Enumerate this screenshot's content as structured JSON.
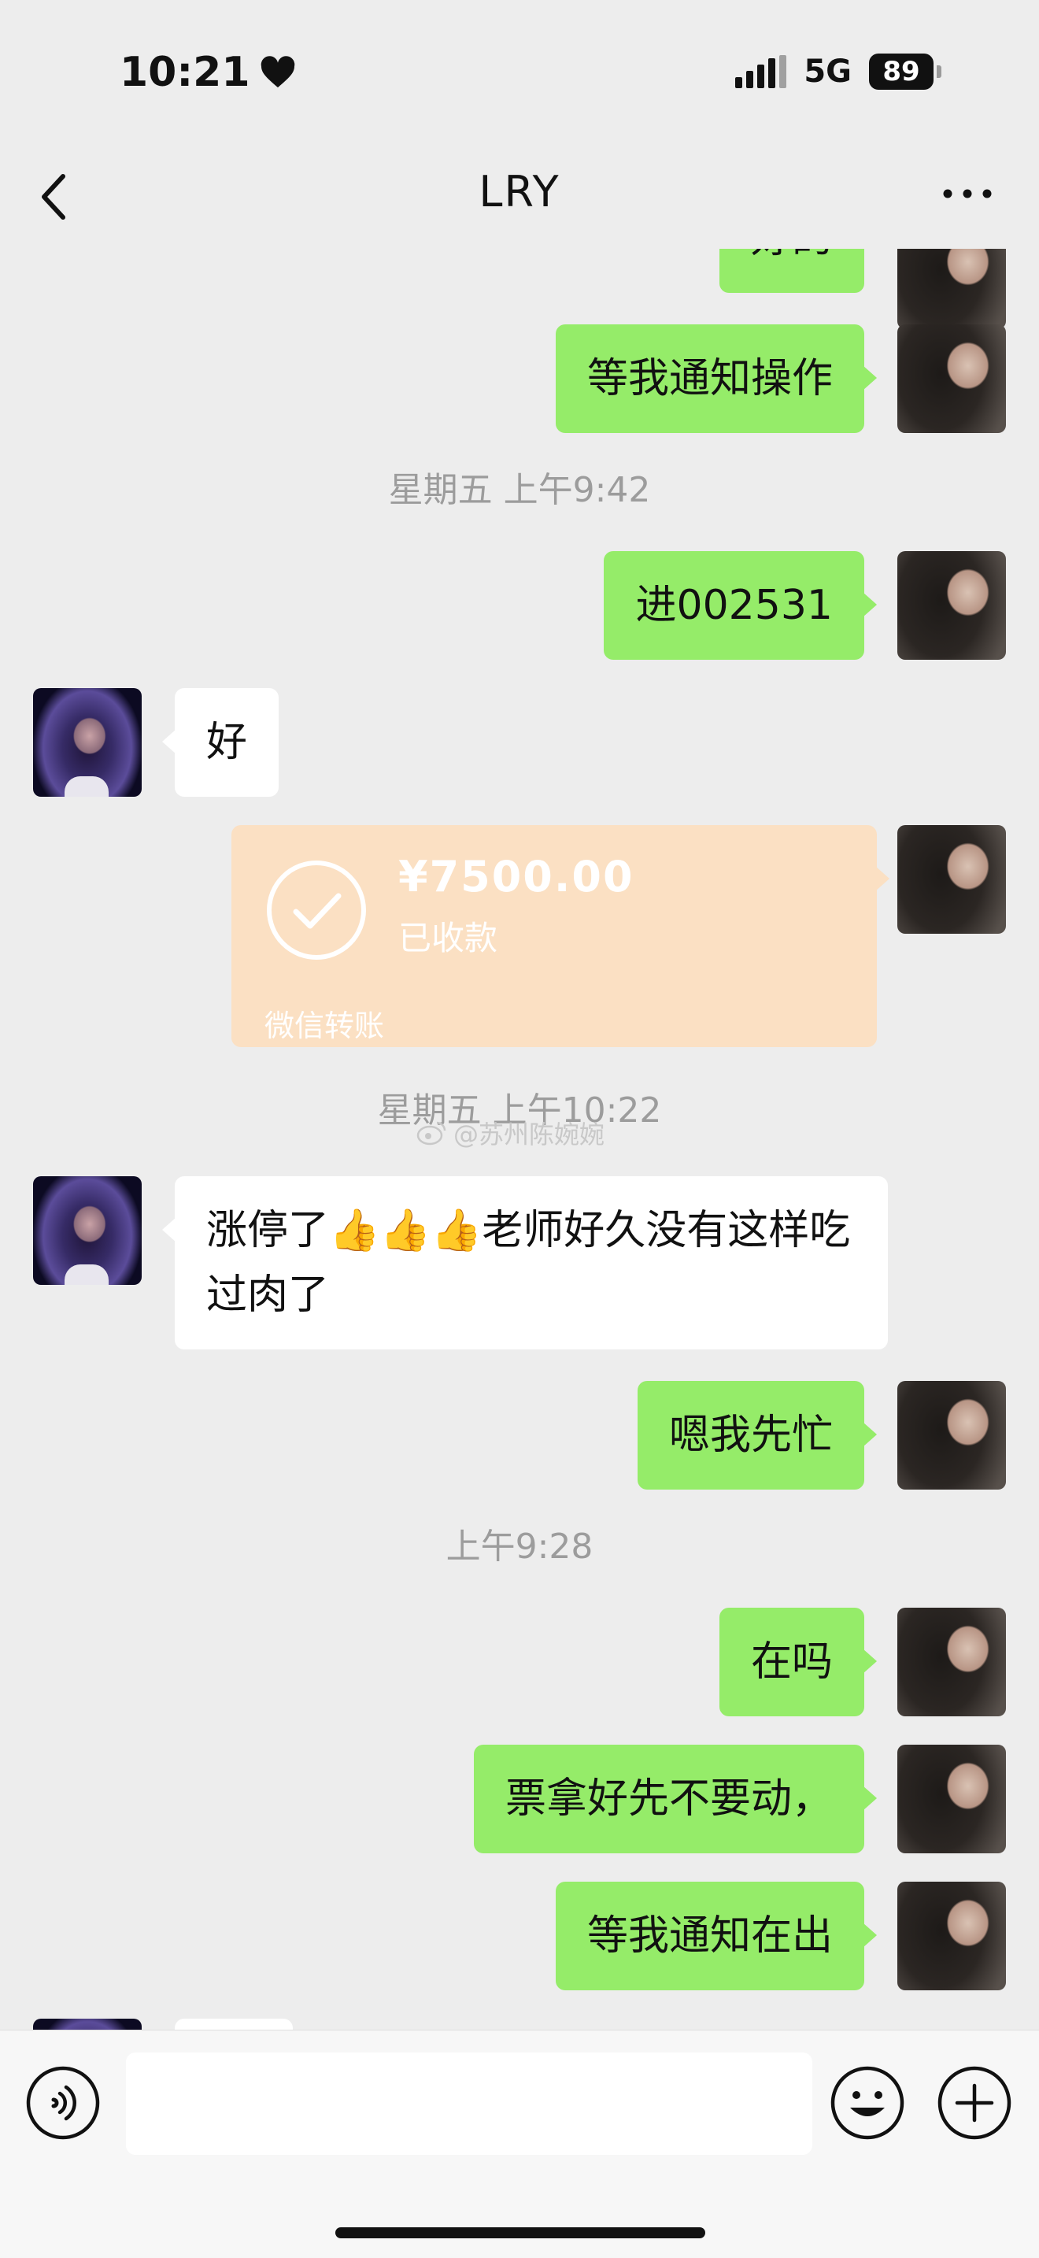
{
  "status_bar": {
    "time": "10:21",
    "heart_icon": "heart-icon",
    "network": "5G",
    "battery": "89"
  },
  "nav": {
    "title": "LRY",
    "back_icon": "chevron-left-icon",
    "more_icon": "more-icon"
  },
  "messages": {
    "partial_top": "好的",
    "m1": "等我通知操作",
    "time1": "星期五 上午9:42",
    "m2": "进002531",
    "m3": "好",
    "transfer": {
      "amount": "¥7500.00",
      "status": "已收款",
      "footer": "微信转账"
    },
    "time2": "星期五 上午10:22",
    "watermark": "@苏州陈婉婉",
    "m4": "涨停了👍👍👍老师好久没有这样吃过肉了",
    "m5": "嗯我先忙",
    "time3": "上午9:28",
    "m6": "在吗",
    "m7": "票拿好先不要动，",
    "m8": "等我通知在出"
  },
  "input_bar": {
    "placeholder": "",
    "voice_icon": "voice-icon",
    "emoji_icon": "emoji-icon",
    "plus_icon": "plus-icon"
  },
  "colors": {
    "background": "#ededed",
    "my_bubble": "#95ec69",
    "other_bubble": "#ffffff",
    "transfer_card": "#fbe0c3",
    "timestamp": "#9c9c9c"
  }
}
